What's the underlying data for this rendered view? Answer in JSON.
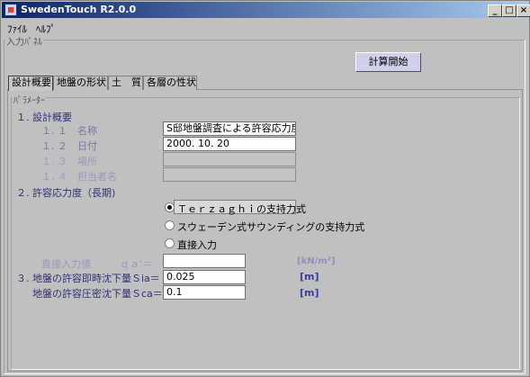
{
  "window": {
    "title": "SwedenTouch  R2.0.0",
    "min": "_",
    "max": "□",
    "close": "×"
  },
  "menu": {
    "file": "ﾌｧｲﾙ",
    "help": "ﾍﾙﾌﾟ"
  },
  "input_panel": {
    "label": "入力ﾊﾟﾈﾙ",
    "start_button": "計算開始"
  },
  "tabs": [
    {
      "label": "設計概要"
    },
    {
      "label": "地盤の形状"
    },
    {
      "label": "土　質"
    },
    {
      "label": "各層の性状"
    }
  ],
  "params": {
    "frame_label": "ﾊﾟﾗﾒｰﾀｰ",
    "section1": "１. 設計概要",
    "name_label": "１. １　名称",
    "name_value": "S邸地盤調査による許容応力度の",
    "date_label": "１. ２　日付",
    "date_value": "2000. 10. 20",
    "place_label": "１. ３　場所",
    "place_value": "",
    "person_label": "１. ４　担当者名",
    "person_value": "",
    "section2": "２. 許容応力度（長期)",
    "radio_terzaghi": "Ｔｅｒｚａｇｈｉの支持力式",
    "radio_swedish": "スウェーデン式サウンディングの支持力式",
    "radio_direct": "直接入力",
    "direct_label": "直接入力値",
    "qa_label": "ｑａ'＝",
    "direct_value": "",
    "direct_unit": "[kN/m²]",
    "sia_label": "３. 地盤の許容即時沈下量Ｓia＝",
    "sia_value": "0.025",
    "sia_unit": "[m]",
    "sca_label": "地盤の許容圧密沈下量Ｓca＝",
    "sca_value": "0.1",
    "sca_unit": "[m]"
  }
}
